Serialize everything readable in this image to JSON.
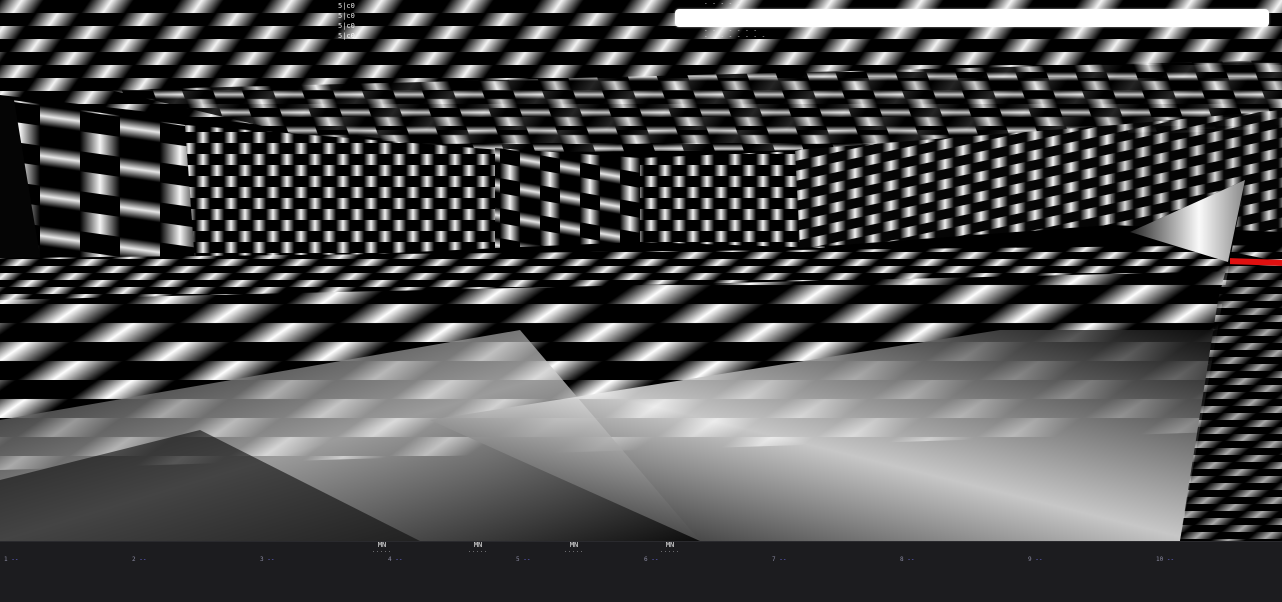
{
  "hud": {
    "debug_lines": [
      "5|c0",
      "5|c0",
      "5|c0",
      "5|c0"
    ],
    "status_text_top": "- - -  - -",
    "status_text_line2": "- - - - - - -",
    "status_text_bottom1": "- - - - -  - -",
    "status_text_bottom2": "- - - - -  - - -",
    "status_bar_color": "#ffffff",
    "marker_color": "#e01010"
  },
  "hotbar": {
    "background": "#1c1c1f",
    "slots": [
      {
        "key": "1",
        "label": ""
      },
      {
        "key": "2",
        "label": ""
      },
      {
        "key": "3",
        "label": "MN"
      },
      {
        "key": "4",
        "label": ""
      },
      {
        "key": "5",
        "label": ""
      },
      {
        "key": "6",
        "label": ""
      },
      {
        "key": "7",
        "label": ""
      },
      {
        "key": "8",
        "label": ""
      },
      {
        "key": "9",
        "label": ""
      },
      {
        "key": "10",
        "label": ""
      }
    ],
    "tags": [
      "MN",
      "MN",
      "MN",
      "MN"
    ],
    "tag_dots": "....."
  }
}
